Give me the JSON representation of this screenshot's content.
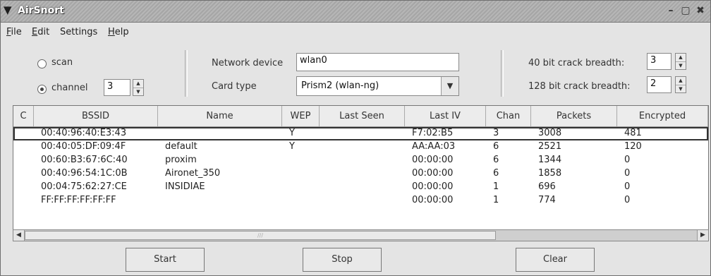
{
  "window": {
    "title": "AirSnort",
    "min_symbol": "–",
    "max_symbol": "▢",
    "close_symbol": "✖"
  },
  "menu": [
    {
      "label": "File",
      "ul": "F",
      "rest": "ile"
    },
    {
      "label": "Edit",
      "ul": "E",
      "rest": "dit"
    },
    {
      "label": "Settings",
      "ul": "",
      "rest": "Settings"
    },
    {
      "label": "Help",
      "ul": "H",
      "rest": "elp"
    }
  ],
  "mode": {
    "scan_label": "scan",
    "channel_label": "channel",
    "channel_value": "3",
    "selected": "channel"
  },
  "device": {
    "network_device_label": "Network device",
    "network_device_value": "wlan0",
    "card_type_label": "Card type",
    "card_type_value": "Prism2 (wlan-ng)"
  },
  "crack": {
    "bit40_label": "40 bit crack breadth:",
    "bit40_value": "3",
    "bit128_label": "128 bit crack breadth:",
    "bit128_value": "2"
  },
  "table": {
    "columns": [
      "C",
      "BSSID",
      "Name",
      "WEP",
      "Last Seen",
      "Last IV",
      "Chan",
      "Packets",
      "Encrypted"
    ],
    "rows": [
      [
        "",
        "00:40:96:40:E3:43",
        "",
        "Y",
        "",
        "F7:02:B5",
        "3",
        "3008",
        "481"
      ],
      [
        "",
        "00:40:05:DF:09:4F",
        "default",
        "Y",
        "",
        "AA:AA:03",
        "6",
        "2521",
        "120"
      ],
      [
        "",
        "00:60:B3:67:6C:40",
        "proxim",
        "",
        "",
        "00:00:00",
        "6",
        "1344",
        "0"
      ],
      [
        "",
        "00:40:96:54:1C:0B",
        "Aironet_350",
        "",
        "",
        "00:00:00",
        "6",
        "1858",
        "0"
      ],
      [
        "",
        "00:04:75:62:27:CE",
        "INSIDIAE",
        "",
        "",
        "00:00:00",
        "1",
        "696",
        "0"
      ],
      [
        "",
        "FF:FF:FF:FF:FF:FF",
        "",
        "",
        "",
        "00:00:00",
        "1",
        "774",
        "0"
      ]
    ],
    "selected_row": 0
  },
  "buttons": {
    "start": "Start",
    "stop": "Stop",
    "clear": "Clear"
  }
}
